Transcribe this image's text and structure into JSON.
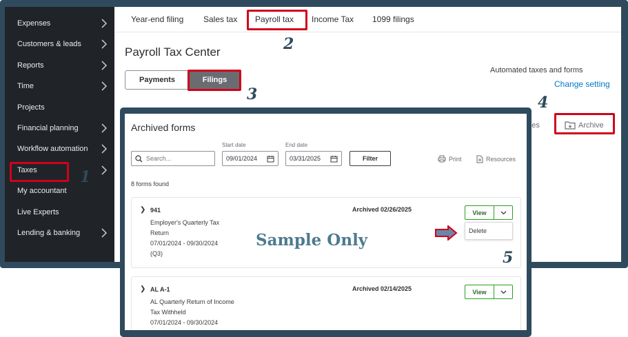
{
  "sidebar": {
    "items": [
      {
        "label": "Expenses",
        "chevron": true
      },
      {
        "label": "Customers & leads",
        "chevron": true
      },
      {
        "label": "Reports",
        "chevron": true
      },
      {
        "label": "Time",
        "chevron": true
      },
      {
        "label": "Projects",
        "chevron": false
      },
      {
        "label": "Financial planning",
        "chevron": true
      },
      {
        "label": "Workflow automation",
        "chevron": true
      },
      {
        "label": "Taxes",
        "chevron": true
      },
      {
        "label": "My accountant",
        "chevron": false
      },
      {
        "label": "Live Experts",
        "chevron": false
      },
      {
        "label": "Lending & banking",
        "chevron": true
      }
    ]
  },
  "tabs": [
    "Year-end filing",
    "Sales tax",
    "Payroll tax",
    "Income Tax",
    "1099 filings"
  ],
  "page": {
    "title": "Payroll Tax Center",
    "segment": {
      "payments": "Payments",
      "filings": "Filings"
    },
    "automated_text": "Automated taxes and forms",
    "change_link": "Change setting",
    "resources_partial": "urces",
    "archive_label": "Archive"
  },
  "archived": {
    "title": "Archived forms",
    "search_placeholder": "Search...",
    "start_label": "Start date",
    "start_value": "09/01/2024",
    "end_label": "End date",
    "end_value": "03/31/2025",
    "filter_label": "Filter",
    "print_label": "Print",
    "resources_label": "Resources",
    "found_text": "8 forms found",
    "cards": [
      {
        "code": "941",
        "desc1": "Employer's Quarterly Tax",
        "desc2": "Return",
        "period": "07/01/2024 - 09/30/2024",
        "quarter": "(Q3)",
        "archived": "Archived 02/26/2025",
        "view": "View"
      },
      {
        "code": "AL A-1",
        "desc1": "AL Quarterly Return of Income",
        "desc2": "Tax Withheld",
        "period": "07/01/2024 - 09/30/2024",
        "quarter": "",
        "archived": "Archived 02/14/2025",
        "view": "View"
      }
    ],
    "dropdown_delete": "Delete"
  },
  "annotations": {
    "n1": "1",
    "n2": "2",
    "n3": "3",
    "n4": "4",
    "n5": "5",
    "watermark": "Sample Only"
  },
  "colors": {
    "frame": "#2f4a5c",
    "highlight": "#d0021b",
    "link": "#0077c5",
    "green": "#2ca01c"
  }
}
